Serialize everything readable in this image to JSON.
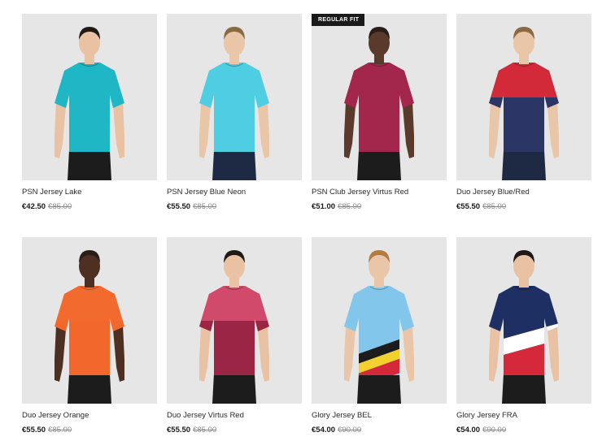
{
  "products": [
    {
      "name": "PSN Jersey Lake",
      "price": "€42.50",
      "was": "€85.00",
      "badge": "",
      "skin": "#e8c2a2",
      "hair": "#1f1a17",
      "colors": [
        "#1fb7c6",
        "#1fb7c6"
      ],
      "split": "none",
      "shorts": "#1c1c1c"
    },
    {
      "name": "PSN Jersey Blue Neon",
      "price": "€55.50",
      "was": "€85.00",
      "badge": "",
      "skin": "#e9c6a7",
      "hair": "#8a6a43",
      "colors": [
        "#4fcde3",
        "#4fcde3"
      ],
      "split": "none",
      "shorts": "#1e2a44"
    },
    {
      "name": "PSN Club Jersey Virtus Red",
      "price": "€51.00",
      "was": "€85.00",
      "badge": "REGULAR FIT",
      "skin": "#5a3a2a",
      "hair": "#2a1e18",
      "colors": [
        "#a3274d",
        "#a3274d"
      ],
      "split": "none",
      "shorts": "#1c1c1c"
    },
    {
      "name": "Duo Jersey Blue/Red",
      "price": "€55.50",
      "was": "€85.00",
      "badge": "",
      "skin": "#e9c6a7",
      "hair": "#8a6a43",
      "colors": [
        "#d32a3a",
        "#2b3566"
      ],
      "split": "horizontal",
      "shorts": "#1e2a44"
    },
    {
      "name": "Duo Jersey Orange",
      "price": "€55.50",
      "was": "€85.00",
      "badge": "",
      "skin": "#4e3023",
      "hair": "#2a1e18",
      "colors": [
        "#f36a2e",
        "#f2672b"
      ],
      "split": "horizontal",
      "shorts": "#1c1c1c"
    },
    {
      "name": "Duo Jersey Virtus Red",
      "price": "€55.50",
      "was": "€85.00",
      "badge": "",
      "skin": "#e8c2a2",
      "hair": "#1f1a17",
      "colors": [
        "#d14a6c",
        "#9b2545"
      ],
      "split": "horizontal",
      "shorts": "#1c1c1c"
    },
    {
      "name": "Glory Jersey BEL",
      "price": "€54.00",
      "was": "€90.00",
      "badge": "",
      "skin": "#e9c6a7",
      "hair": "#b47a40",
      "colors": [
        "#82c7eb",
        "#82c7eb"
      ],
      "split": "bel",
      "shorts": "#1c1c1c"
    },
    {
      "name": "Glory Jersey FRA",
      "price": "€54.00",
      "was": "€90.00",
      "badge": "",
      "skin": "#e8c2a2",
      "hair": "#1f1a17",
      "colors": [
        "#1e2f63",
        "#d6283b"
      ],
      "split": "fra",
      "shorts": "#1c1c1c"
    }
  ]
}
